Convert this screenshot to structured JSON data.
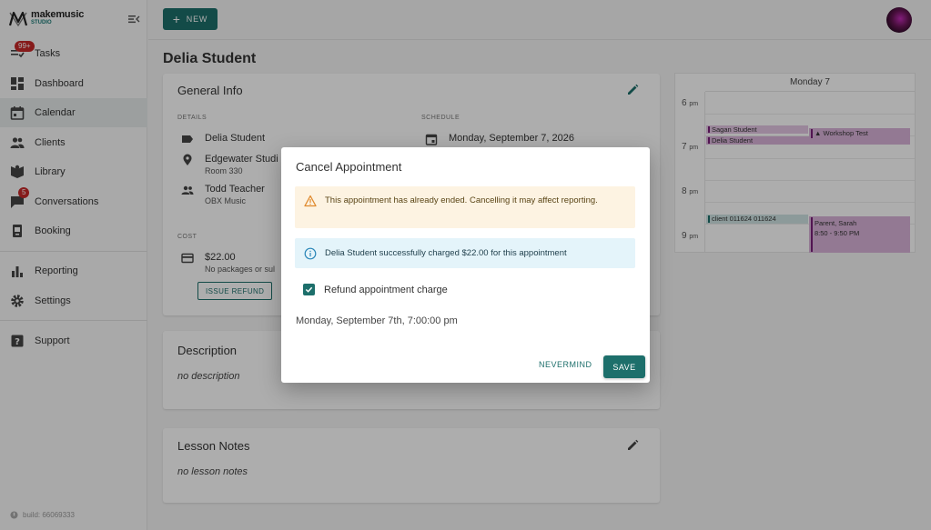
{
  "sidebar": {
    "logo_line1": "makemusic",
    "logo_line2": "STUDIO",
    "items": [
      {
        "label": "Tasks",
        "badge": "99+"
      },
      {
        "label": "Dashboard"
      },
      {
        "label": "Calendar"
      },
      {
        "label": "Clients"
      },
      {
        "label": "Library"
      },
      {
        "label": "Conversations",
        "badge": "5"
      },
      {
        "label": "Booking"
      },
      {
        "label": "Reporting"
      },
      {
        "label": "Settings"
      },
      {
        "label": "Support"
      }
    ],
    "build": "build: 66069333"
  },
  "topbar": {
    "new_label": "NEW"
  },
  "page": {
    "title": "Delia Student",
    "general_info": {
      "heading": "General Info",
      "details_label": "DETAILS",
      "schedule_label": "SCHEDULE",
      "student": "Delia Student",
      "location": "Edgewater Studi",
      "room": "Room 330",
      "teacher": "Todd Teacher",
      "org": "OBX Music",
      "schedule_date": "Monday, September 7, 2026",
      "cost_label": "COST",
      "cost": "$22.00",
      "cost_note": "No packages or sul",
      "refund_label": "ISSUE REFUND"
    },
    "description": {
      "heading": "Description",
      "body": "no description"
    },
    "lesson_notes": {
      "heading": "Lesson Notes",
      "body": "no lesson notes"
    }
  },
  "calendar": {
    "day": "Monday 7",
    "hours": [
      {
        "num": "6",
        "ampm": "pm"
      },
      {
        "num": "7",
        "ampm": "pm"
      },
      {
        "num": "8",
        "ampm": "pm"
      },
      {
        "num": "9",
        "ampm": "pm"
      }
    ],
    "events": [
      {
        "title": "Sagan Student"
      },
      {
        "title": "Delia Student"
      },
      {
        "title": "Workshop Test"
      },
      {
        "title": "client 011624 011624"
      },
      {
        "title": "Parent, Sarah",
        "time": "8:50 - 9:50 PM"
      }
    ]
  },
  "dialog": {
    "title": "Cancel Appointment",
    "warning": "This appointment has already ended. Cancelling it may affect reporting.",
    "info": "Delia Student successfully charged $22.00 for this appointment",
    "checkbox_label": "Refund appointment charge",
    "checkbox_checked": true,
    "date": "Monday, September 7th, 7:00:00 pm",
    "nevermind_label": "NEVERMIND",
    "save_label": "SAVE"
  },
  "colors": {
    "accent": "#1d6f6b",
    "badge": "#c62828",
    "warning_bg": "#fdf3e2",
    "info_bg": "#e4f4fa",
    "event_purple": "#d9b3d9"
  }
}
